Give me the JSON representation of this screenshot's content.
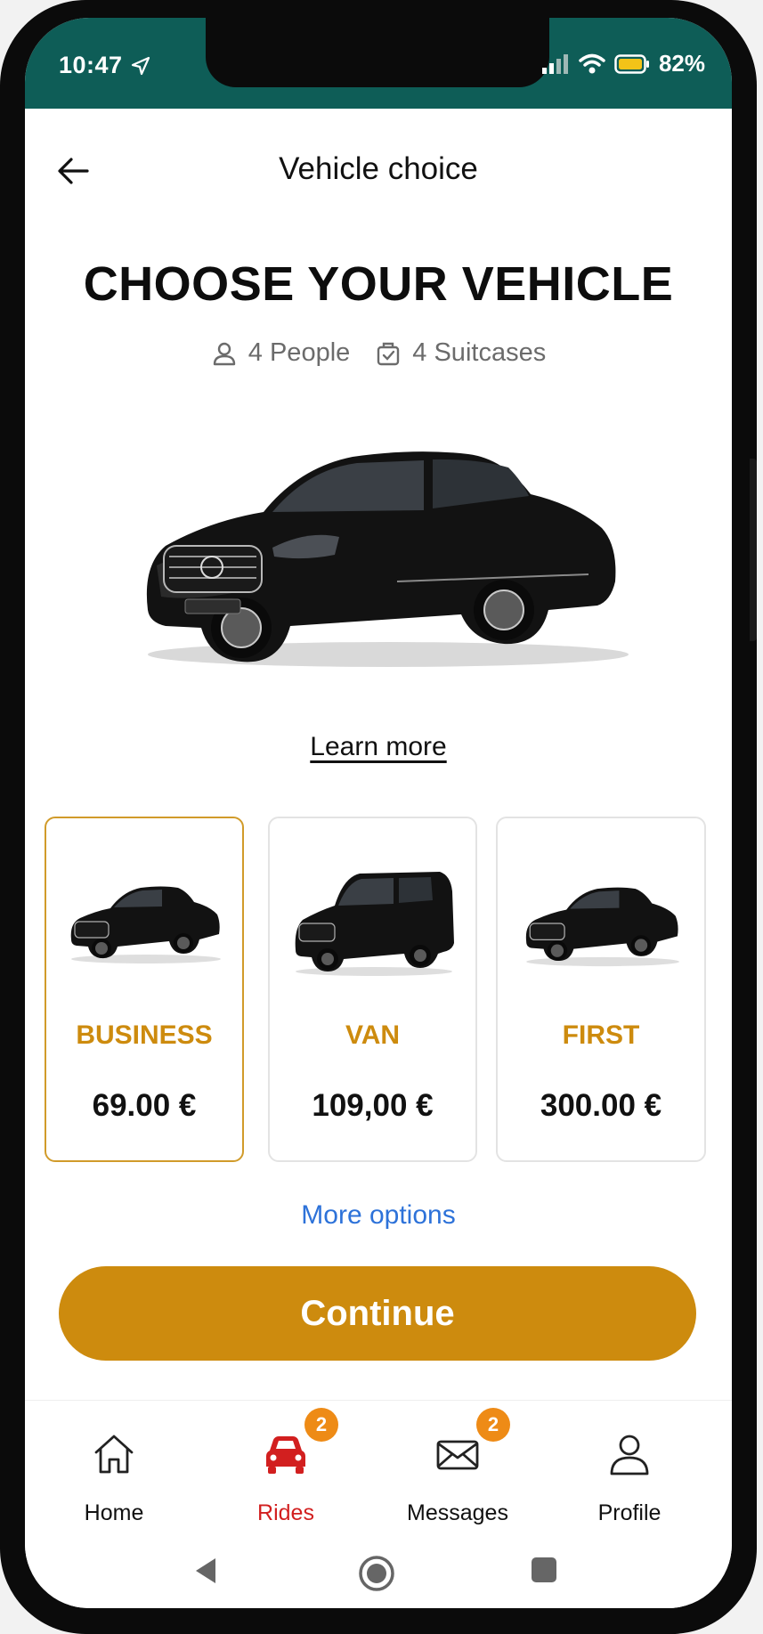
{
  "status_bar": {
    "time": "10:47",
    "battery_percent": "82%",
    "background_color": "#0e5d57"
  },
  "header": {
    "title": "Vehicle choice",
    "back_icon": "arrow-left-icon"
  },
  "main": {
    "heading": "CHOOSE YOUR VEHICLE",
    "capacity": {
      "people": "4 People",
      "suitcases": "4 Suitcases"
    },
    "learn_more": "Learn more",
    "vehicles": [
      {
        "category": "BUSINESS",
        "price": "69.00 €",
        "selected": true
      },
      {
        "category": "VAN",
        "price": "109,00 €",
        "selected": false
      },
      {
        "category": "FIRST",
        "price": "300.00 €",
        "selected": false
      }
    ],
    "more_options": "More options",
    "continue_label": "Continue"
  },
  "bottom_nav": {
    "items": [
      {
        "label": "Home",
        "icon": "home-icon",
        "active": false,
        "badge": ""
      },
      {
        "label": "Rides",
        "icon": "car-icon",
        "active": true,
        "badge": "2"
      },
      {
        "label": "Messages",
        "icon": "mail-icon",
        "active": false,
        "badge": "2"
      },
      {
        "label": "Profile",
        "icon": "user-icon",
        "active": false,
        "badge": ""
      }
    ]
  },
  "colors": {
    "accent": "#cd8b0e",
    "active_nav": "#d21f1f",
    "link": "#2d72d9",
    "badge": "#ee8b16"
  }
}
